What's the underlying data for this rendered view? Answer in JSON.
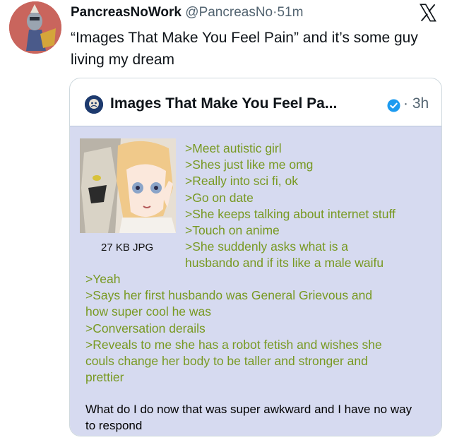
{
  "tweet": {
    "display_name": "PancreasNoWork",
    "handle": "@PancreasNo",
    "separator": "·",
    "time": "51m",
    "text": "“Images That Make You Feel Pain” and it’s some guy living my dream"
  },
  "quote": {
    "name": "Images That Make You Feel Pa...",
    "separator": "·",
    "time": "3h",
    "post": {
      "file_info": "27 KB JPG",
      "greentext_lines": [
        ">Meet autistic girl",
        ">Shes just like me omg",
        ">Really into sci fi, ok",
        ">Go on date",
        ">She keeps talking about internet stuff",
        ">Touch on anime",
        ">She suddenly asks what is a",
        "husbando and if its like a male waifu",
        ">Yeah",
        ">Says her first husbando was General Grievous and",
        "how super cool he was",
        ">Conversation derails",
        ">Reveals to me she has a robot fetish and wishes she",
        "couls change her body to be taller and stronger and",
        "prettier"
      ],
      "comment": "What do I do now that was super awkward and I have no way to respond"
    }
  },
  "colors": {
    "greentext": "#789922",
    "post_background": "#d6daf0",
    "muted": "#536471",
    "verified": "#1d9bf0"
  },
  "icons": [
    "x-logo-icon",
    "verified-badge-icon"
  ]
}
